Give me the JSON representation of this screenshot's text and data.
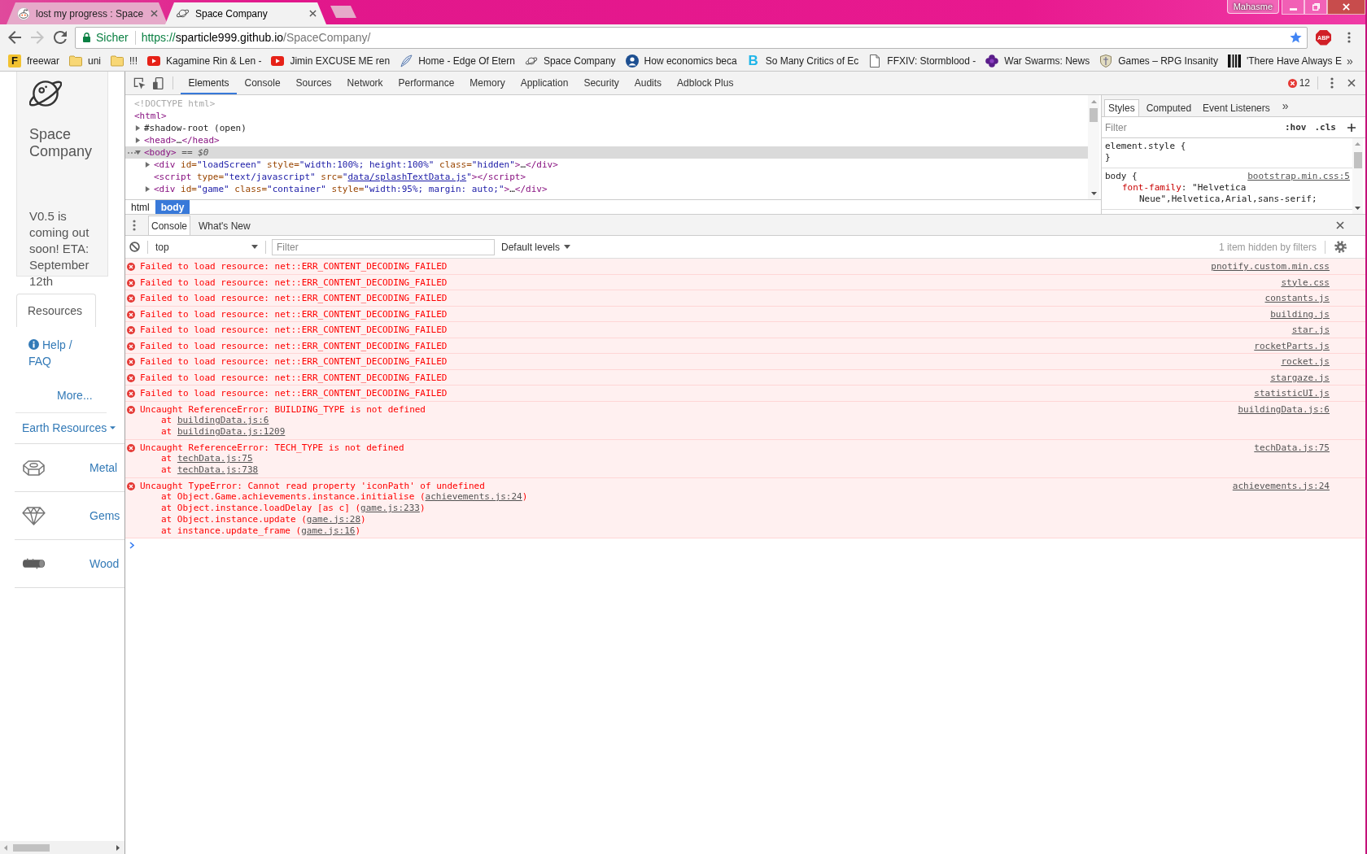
{
  "window": {
    "profile": "Mahasme"
  },
  "tabs": [
    {
      "title": "lost my progress : Space",
      "selected": false
    },
    {
      "title": "Space Company",
      "selected": true
    }
  ],
  "nav_buttons": [
    {
      "kind": "back",
      "disabled": false
    },
    {
      "kind": "forward",
      "disabled": true
    },
    {
      "kind": "reload",
      "disabled": false
    }
  ],
  "address_bar": {
    "security": "Sicher",
    "scheme": "https://",
    "host": "sparticle999.github.io",
    "path": "/SpaceCompany/"
  },
  "extension_badge": "ABP",
  "bookmarks": [
    {
      "label": "freewar",
      "icon_text": "F"
    },
    {
      "label": "uni"
    },
    {
      "label": "!!!"
    },
    {
      "label": "Kagamine Rin & Len -"
    },
    {
      "label": "Jimin EXCUSE ME ren"
    },
    {
      "label": "Home - Edge Of Etern"
    },
    {
      "label": "Space Company"
    },
    {
      "label": "How economics beca"
    },
    {
      "label": "So Many Critics of Ec",
      "icon_text": "B"
    },
    {
      "label": "FFXIV: Stormblood -"
    },
    {
      "label": "War Swarms: News"
    },
    {
      "label": "Games – RPG Insanity"
    },
    {
      "label": "'There Have Always E"
    }
  ],
  "bookmarks_overflow": "»",
  "page": {
    "title": "Space Company",
    "announcement": "V0.5 is coming out soon! ETA: September 12th",
    "tabs": [
      {
        "label": "Resources",
        "selected": true
      }
    ],
    "help": "Help / FAQ",
    "more": "More...",
    "category": "Earth Resources",
    "resources": [
      {
        "name": "Metal"
      },
      {
        "name": "Gems"
      },
      {
        "name": "Wood"
      }
    ]
  },
  "devtools": {
    "tabs": [
      {
        "label": "Elements",
        "selected": true
      },
      {
        "label": "Console",
        "selected": false
      },
      {
        "label": "Sources",
        "selected": false
      },
      {
        "label": "Network",
        "selected": false
      },
      {
        "label": "Performance",
        "selected": false
      },
      {
        "label": "Memory",
        "selected": false
      },
      {
        "label": "Application",
        "selected": false
      },
      {
        "label": "Security",
        "selected": false
      },
      {
        "label": "Audits",
        "selected": false
      },
      {
        "label": "Adblock Plus",
        "selected": false
      }
    ],
    "error_count": "12",
    "dom_tree": [
      {
        "tokens": [
          {
            "text": "<!DOCTYPE html>",
            "kind": "doctype"
          }
        ],
        "selected": false
      },
      {
        "tokens": [
          {
            "text": "<html>",
            "kind": "tag"
          }
        ],
        "selected": false,
        "children": [
          {
            "tokens": [
              {
                "text": "#shadow-root (open)",
                "kind": "plain"
              }
            ],
            "expanded": false,
            "selected": false
          },
          {
            "tokens": [
              {
                "text": "<head>",
                "kind": "tag"
              },
              {
                "text": "…",
                "kind": "plain"
              },
              {
                "text": "</head>",
                "kind": "tag"
              }
            ],
            "expanded": false,
            "selected": false
          },
          {
            "tokens": [
              {
                "text": "<body>",
                "kind": "tag"
              },
              {
                "text": " == $0",
                "kind": "marker"
              }
            ],
            "expanded": true,
            "selected": true,
            "children": [
              {
                "tokens": [
                  {
                    "text": "<div",
                    "kind": "tag"
                  },
                  {
                    "text": " id=",
                    "kind": "attr"
                  },
                  {
                    "text": "\"loadScreen\"",
                    "kind": "value"
                  },
                  {
                    "text": " style=",
                    "kind": "attr"
                  },
                  {
                    "text": "\"width:100%; height:100%\"",
                    "kind": "value"
                  },
                  {
                    "text": " class=",
                    "kind": "attr"
                  },
                  {
                    "text": "\"hidden\"",
                    "kind": "value"
                  },
                  {
                    "text": ">",
                    "kind": "tag"
                  },
                  {
                    "text": "…",
                    "kind": "plain"
                  },
                  {
                    "text": "</div>",
                    "kind": "tag"
                  }
                ],
                "expanded": false,
                "selected": false
              },
              {
                "tokens": [
                  {
                    "text": "<script",
                    "kind": "tag"
                  },
                  {
                    "text": " type=",
                    "kind": "attr"
                  },
                  {
                    "text": "\"text/javascript\"",
                    "kind": "value"
                  },
                  {
                    "text": " src=",
                    "kind": "attr"
                  },
                  {
                    "text": "\"",
                    "kind": "value"
                  },
                  {
                    "text": "data/splashTextData.js",
                    "kind": "link"
                  },
                  {
                    "text": "\"",
                    "kind": "value"
                  },
                  {
                    "text": "></script>",
                    "kind": "tag"
                  }
                ],
                "selected": false
              },
              {
                "tokens": [
                  {
                    "text": "<div",
                    "kind": "tag"
                  },
                  {
                    "text": " id=",
                    "kind": "attr"
                  },
                  {
                    "text": "\"game\"",
                    "kind": "value"
                  },
                  {
                    "text": " class=",
                    "kind": "attr"
                  },
                  {
                    "text": "\"container\"",
                    "kind": "value"
                  },
                  {
                    "text": " style=",
                    "kind": "attr"
                  },
                  {
                    "text": "\"width:95%; margin: auto;\"",
                    "kind": "value"
                  },
                  {
                    "text": ">",
                    "kind": "tag"
                  },
                  {
                    "text": "…",
                    "kind": "plain"
                  },
                  {
                    "text": "</div>",
                    "kind": "tag"
                  }
                ],
                "expanded": false,
                "selected": false
              }
            ]
          }
        ]
      }
    ],
    "breadcrumbs": [
      {
        "label": "html",
        "selected": false
      },
      {
        "label": "body",
        "selected": true
      }
    ],
    "styles_tabs": [
      {
        "label": "Styles",
        "selected": true
      },
      {
        "label": "Computed",
        "selected": false
      },
      {
        "label": "Event Listeners",
        "selected": false
      }
    ],
    "styles_overflow": "»",
    "styles_filter": {
      "placeholder": "Filter"
    },
    "styles_toggles": [
      ":hov",
      ".cls"
    ],
    "rules": [
      {
        "header": "element.style {",
        "footer": "}"
      },
      {
        "header": "body {",
        "source": "bootstrap.min.css:5",
        "props": [
          {
            "name": "font-family",
            "value": ": \"Helvetica Neue\",Helvetica,Arial,sans-serif;"
          }
        ]
      }
    ]
  },
  "drawer": {
    "tabs": [
      {
        "label": "Console",
        "selected": true
      },
      {
        "label": "What's New",
        "selected": false
      }
    ]
  },
  "console": {
    "context": "top",
    "filter": {
      "placeholder": "Filter"
    },
    "levels": "Default levels",
    "hidden_note": "1 item hidden by filters",
    "messages": [
      {
        "kind": "error",
        "text": "Failed to load resource: net::ERR_CONTENT_DECODING_FAILED",
        "source": "pnotify.custom.min.css"
      },
      {
        "kind": "error",
        "text": "Failed to load resource: net::ERR_CONTENT_DECODING_FAILED",
        "source": "style.css"
      },
      {
        "kind": "error",
        "text": "Failed to load resource: net::ERR_CONTENT_DECODING_FAILED",
        "source": "constants.js"
      },
      {
        "kind": "error",
        "text": "Failed to load resource: net::ERR_CONTENT_DECODING_FAILED",
        "source": "building.js"
      },
      {
        "kind": "error",
        "text": "Failed to load resource: net::ERR_CONTENT_DECODING_FAILED",
        "source": "star.js"
      },
      {
        "kind": "error",
        "text": "Failed to load resource: net::ERR_CONTENT_DECODING_FAILED",
        "source": "rocketParts.js"
      },
      {
        "kind": "error",
        "text": "Failed to load resource: net::ERR_CONTENT_DECODING_FAILED",
        "source": "rocket.js"
      },
      {
        "kind": "error",
        "text": "Failed to load resource: net::ERR_CONTENT_DECODING_FAILED",
        "source": "stargaze.js"
      },
      {
        "kind": "error",
        "text": "Failed to load resource: net::ERR_CONTENT_DECODING_FAILED",
        "source": "statisticUI.js"
      },
      {
        "kind": "error",
        "text": "Uncaught ReferenceError: BUILDING_TYPE is not defined",
        "source": "buildingData.js:6",
        "stack": [
          {
            "text": "at ",
            "link": "buildingData.js:6"
          },
          {
            "text": "at ",
            "link": "buildingData.js:1209"
          }
        ]
      },
      {
        "kind": "error",
        "text": "Uncaught ReferenceError: TECH_TYPE is not defined",
        "source": "techData.js:75",
        "stack": [
          {
            "text": "at ",
            "link": "techData.js:75"
          },
          {
            "text": "at ",
            "link": "techData.js:738"
          }
        ]
      },
      {
        "kind": "error",
        "text": "Uncaught TypeError: Cannot read property 'iconPath' of undefined",
        "source": "achievements.js:24",
        "stack": [
          {
            "text": "at Object.Game.achievements.instance.initialise (",
            "link": "achievements.js:24",
            "after": ")"
          },
          {
            "text": "at Object.instance.loadDelay [as c] (",
            "link": "game.js:233",
            "after": ")"
          },
          {
            "text": "at Object.instance.update (",
            "link": "game.js:28",
            "after": ")"
          },
          {
            "text": "at instance.update_frame (",
            "link": "game.js:16",
            "after": ")"
          }
        ]
      }
    ]
  }
}
